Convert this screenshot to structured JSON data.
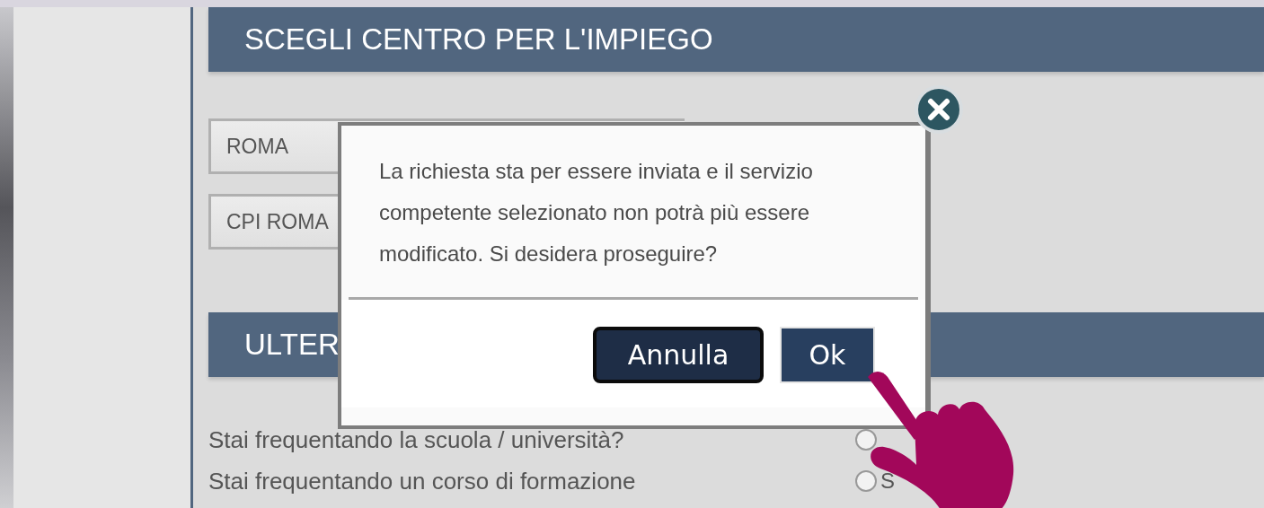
{
  "section_1": {
    "title": "SCEGLI CENTRO PER L'IMPIEGO",
    "selects": [
      {
        "value": "ROMA"
      },
      {
        "value": "CPI ROMA"
      }
    ]
  },
  "section_2": {
    "title": "ULTER"
  },
  "questions": [
    {
      "text": "Stai frequentando la scuola / università?",
      "radios": [
        {
          "selected": false
        }
      ]
    },
    {
      "text": "Stai frequentando un corso di formazione",
      "radios": [
        {
          "label": "S",
          "selected": false
        }
      ]
    }
  ],
  "dialog": {
    "message": "La richiesta sta per essere inviata e il servizio competente selezionato non potrà più essere modificato. Si desidera proseguire?",
    "buttons": [
      {
        "label": "Annulla",
        "kind": "secondary"
      },
      {
        "label": "Ok",
        "kind": "primary"
      }
    ]
  }
}
